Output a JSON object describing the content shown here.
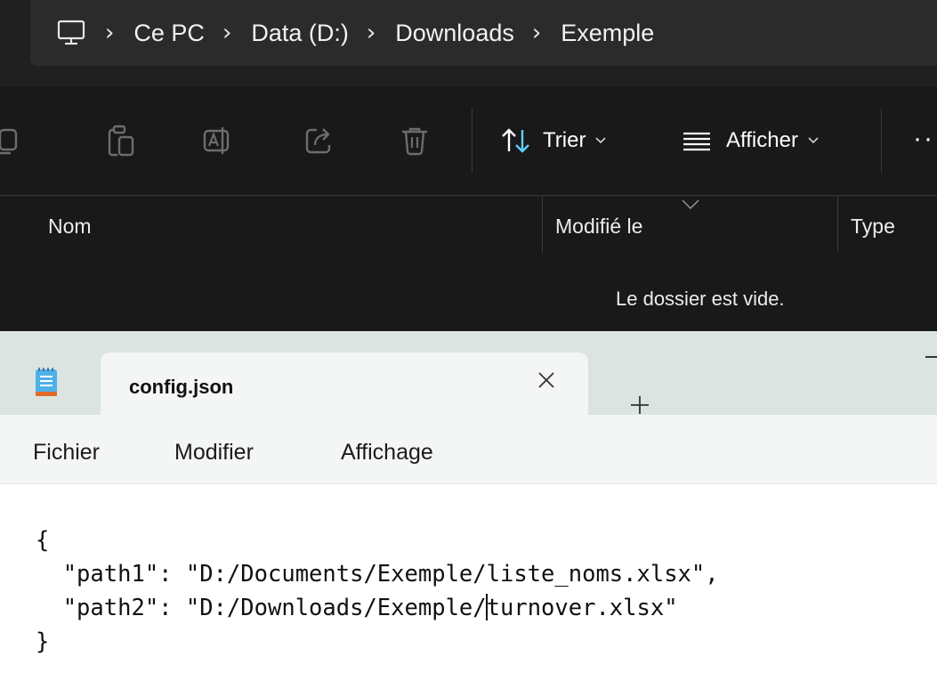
{
  "explorer": {
    "breadcrumb": [
      "Ce PC",
      "Data (D:)",
      "Downloads",
      "Exemple"
    ],
    "toolbar": {
      "sort_label": "Trier",
      "view_label": "Afficher"
    },
    "columns": {
      "name": "Nom",
      "modified": "Modifié le",
      "type": "Type"
    },
    "empty_message": "Le dossier est vide."
  },
  "notepad": {
    "tab_title": "config.json",
    "menu": {
      "file": "Fichier",
      "edit": "Modifier",
      "view": "Affichage"
    },
    "content": {
      "line1": "{",
      "line2": "  \"path1\": \"D:/Documents/Exemple/liste_noms.xlsx\",",
      "line3_before_cursor": "  \"path2\": \"D:/Downloads/Exemple/",
      "line3_after_cursor": "turnover.xlsx\"",
      "line4": "}"
    }
  },
  "colors": {
    "explorer_bg": "#191919",
    "address_bg": "#2b2b2b",
    "notepad_tabstrip": "#dbe4e0",
    "notepad_menubar": "#f3f6f4",
    "accent_blue": "#60cdff"
  }
}
